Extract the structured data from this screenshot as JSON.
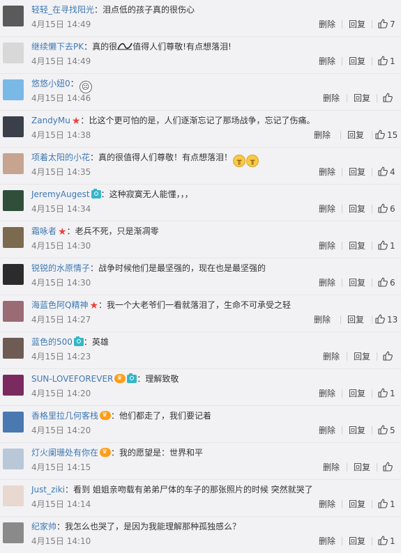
{
  "actions": {
    "delete_label": "删除",
    "reply_label": "回复"
  },
  "comments": [
    {
      "user": "轻轻_在寻找阳光",
      "badges": [],
      "text": "泪点低的孩子真的很伤心",
      "emojis": [],
      "time": "4月15日 14:49",
      "likes": "7",
      "avatar_color": "#5a5a5a"
    },
    {
      "user": "继续懒下去PK",
      "badges": [],
      "text": "真的很",
      "text2": "值得人们尊敬!有点想落泪!",
      "emojis": [],
      "inline_icon": "wave-icon",
      "time": "4月15日 14:49",
      "likes": "1",
      "avatar_color": "#d8d8d8"
    },
    {
      "user": "悠悠小妞0",
      "badges": [],
      "text": "",
      "emojis": [
        "face"
      ],
      "time": "4月15日 14:46",
      "likes": "",
      "avatar_color": "#7ab9e6"
    },
    {
      "user": "ZandyMu",
      "badges": [
        "star"
      ],
      "text": "比这个更可怕的是，人们逐渐忘记了那场战争，忘记了伤痛。",
      "emojis": [],
      "time": "4月15日 14:38",
      "likes": "15",
      "avatar_color": "#3a3f4a"
    },
    {
      "user": "项着太阳的小花",
      "badges": [],
      "text": "真的很值得人们尊敬！有点想落泪！",
      "emojis": [
        "cry",
        "cry"
      ],
      "time": "4月15日 14:35",
      "likes": "4",
      "avatar_color": "#c6a48f"
    },
    {
      "user": "JeremyAugest",
      "badges": [
        "camera"
      ],
      "text": "这种寂寞无人能懂，，，",
      "emojis": [],
      "time": "4月15日 14:34",
      "likes": "6",
      "avatar_color": "#2f4f3a"
    },
    {
      "user": "霜咏者",
      "badges": [
        "star"
      ],
      "text": "老兵不死，只是渐凋零",
      "emojis": [],
      "time": "4月15日 14:30",
      "likes": "1",
      "avatar_color": "#7c6a4e"
    },
    {
      "user": "锐锐的水原情子",
      "badges": [],
      "text": "战争时候他们是最坚强的，现在也是最坚强的",
      "emojis": [],
      "time": "4月15日 14:30",
      "likes": "6",
      "avatar_color": "#2b2b2b"
    },
    {
      "user": "海蓝色阿Q精神",
      "badges": [
        "star"
      ],
      "text": "我一个大老爷们一看就落泪了，生命不可承受之轻",
      "emojis": [],
      "time": "4月15日 14:27",
      "likes": "13",
      "avatar_color": "#9a6b74"
    },
    {
      "user": "蓝色的500",
      "badges": [
        "camera"
      ],
      "text": "英雄",
      "emojis": [],
      "time": "4月15日 14:23",
      "likes": "",
      "avatar_color": "#6e5c54"
    },
    {
      "user": "SUN-LOVEFOREVER",
      "badges": [
        "vip",
        "camera"
      ],
      "text": "理解致敬",
      "emojis": [],
      "time": "4月15日 14:20",
      "likes": "1",
      "avatar_color": "#7a2a5e"
    },
    {
      "user": "香格里拉几何客栈",
      "badges": [
        "vip"
      ],
      "text": "他们都走了，我们要记着",
      "emojis": [],
      "time": "4月15日 14:20",
      "likes": "5",
      "avatar_color": "#4a78b0"
    },
    {
      "user": "灯火阑珊处有你在",
      "badges": [
        "vip"
      ],
      "text": "我的愿望是：世界和平",
      "emojis": [],
      "time": "4月15日 14:15",
      "likes": "",
      "avatar_color": "#b9c8d8"
    },
    {
      "user": "Just_ziki",
      "badges": [],
      "text": "看到 姐姐亲吻载有弟弟尸体的车子的那张照片的时候   突然就哭了",
      "emojis": [],
      "time": "4月15日 14:14",
      "likes": "1",
      "avatar_color": "#e8d8d0"
    },
    {
      "user": "纪家帅",
      "badges": [],
      "text": "我怎么也哭了，是因为我能理解那种孤独感么？",
      "emojis": [],
      "time": "4月15日 14:10",
      "likes": "1",
      "avatar_color": "#8a8a8a"
    }
  ]
}
